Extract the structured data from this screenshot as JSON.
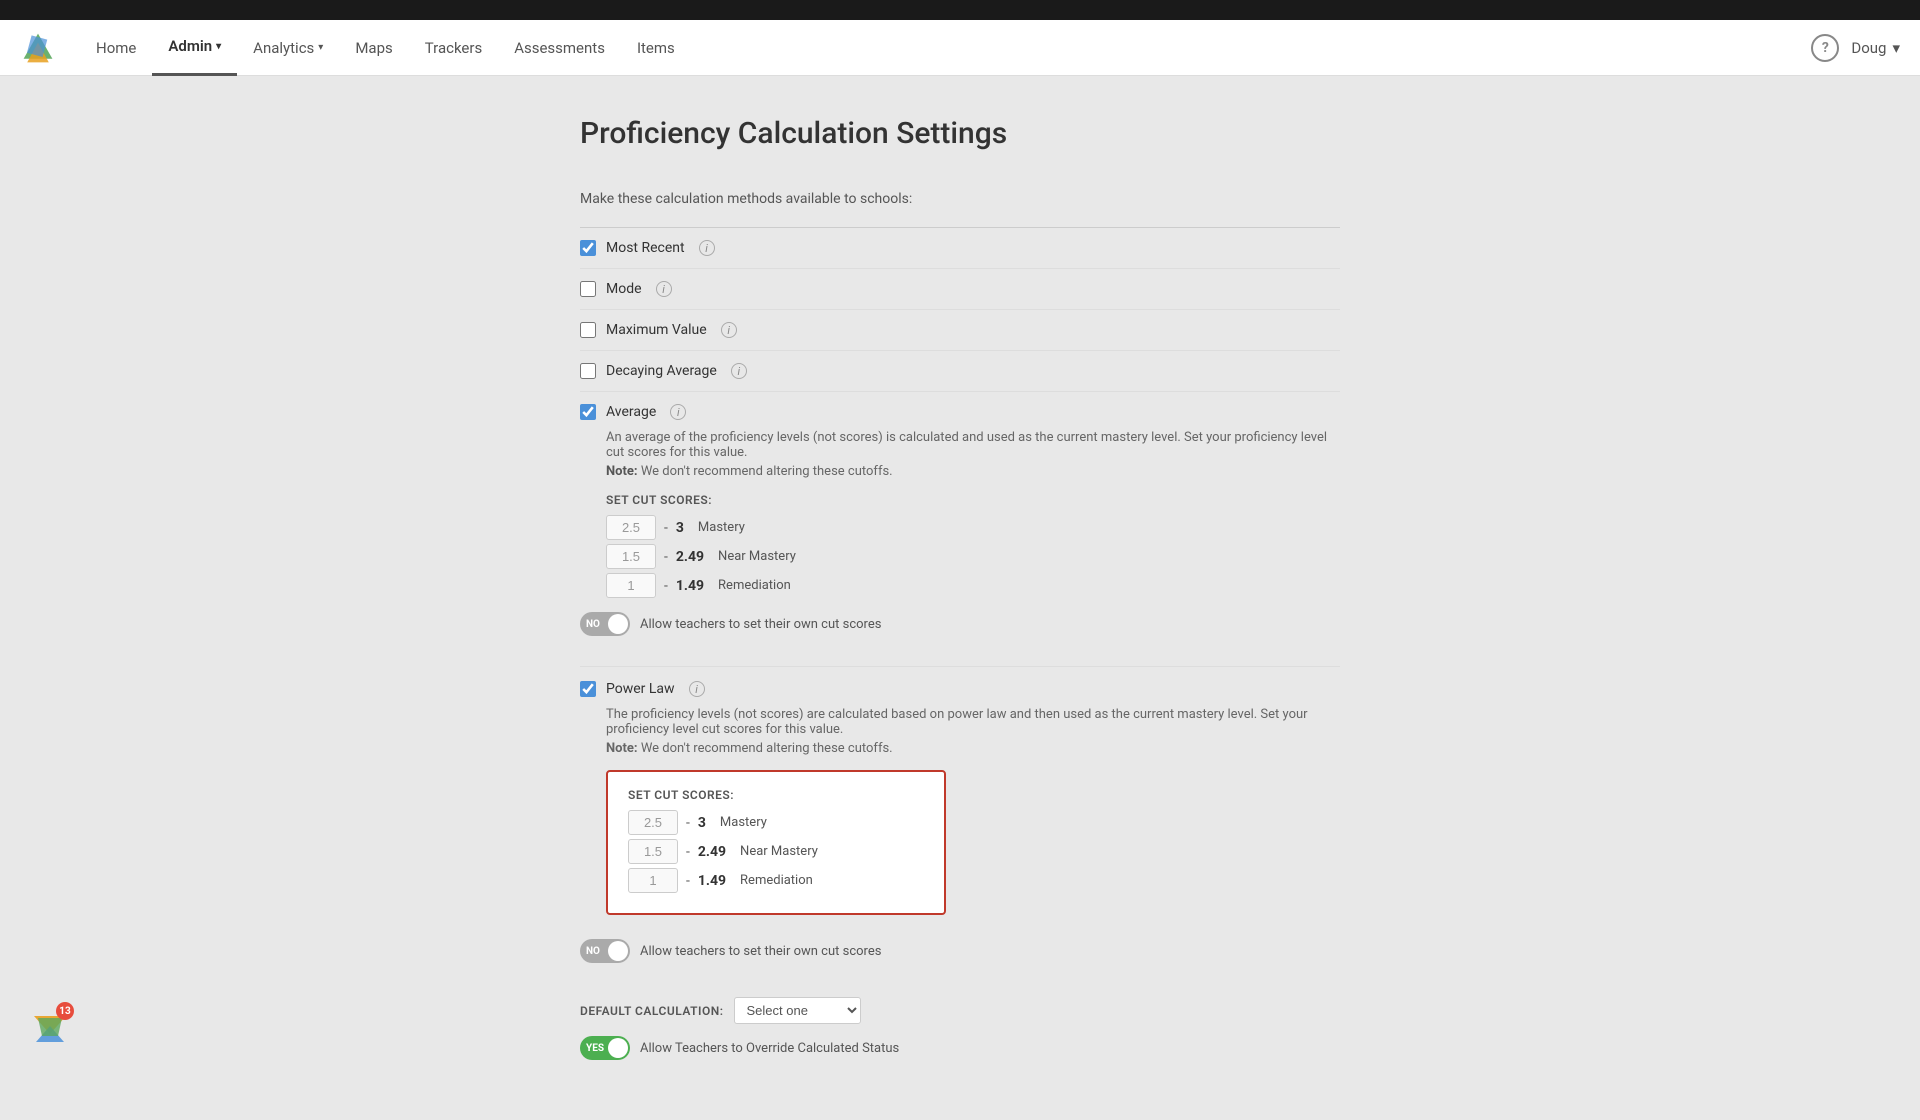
{
  "topBar": {},
  "navbar": {
    "brand": "Mastery Connect",
    "items": [
      {
        "label": "Home",
        "active": false,
        "hasArrow": false
      },
      {
        "label": "Admin",
        "active": true,
        "hasArrow": true
      },
      {
        "label": "Analytics",
        "active": false,
        "hasArrow": true
      },
      {
        "label": "Maps",
        "active": false,
        "hasArrow": false
      },
      {
        "label": "Trackers",
        "active": false,
        "hasArrow": false
      },
      {
        "label": "Assessments",
        "active": false,
        "hasArrow": false
      },
      {
        "label": "Items",
        "active": false,
        "hasArrow": false
      }
    ],
    "helpLabel": "?",
    "userName": "Doug",
    "userArrow": "▾"
  },
  "page": {
    "title": "Proficiency Calculation Settings",
    "sectionLabel": "Make these calculation methods available to schools:",
    "options": [
      {
        "label": "Most Recent",
        "checked": true,
        "hasInfo": true
      },
      {
        "label": "Mode",
        "checked": false,
        "hasInfo": true
      },
      {
        "label": "Maximum Value",
        "checked": false,
        "hasInfo": true
      },
      {
        "label": "Decaying Average",
        "checked": false,
        "hasInfo": true
      }
    ],
    "average": {
      "label": "Average",
      "checked": true,
      "hasInfo": true,
      "description": "An average of the proficiency levels (not scores) is calculated and used as the current mastery level. Set your proficiency level cut scores for this value.",
      "note": "Note:",
      "noteText": " We don't recommend altering these cutoffs.",
      "setCutScores": "SET CUT SCORES:",
      "scores": [
        {
          "from": "2.5",
          "to": "3",
          "label": "Mastery"
        },
        {
          "from": "1.5",
          "to": "2.49",
          "label": "Near Mastery"
        },
        {
          "from": "1",
          "to": "1.49",
          "label": "Remediation"
        }
      ],
      "toggle": "NO",
      "toggleText": "Allow teachers to set their own cut scores"
    },
    "powerLaw": {
      "label": "Power Law",
      "checked": true,
      "hasInfo": true,
      "description": "The proficiency levels (not scores) are calculated based on power law and then used as the current mastery level. Set your proficiency level cut scores for this value.",
      "note": "Note:",
      "noteText": " We don't recommend altering these cutoffs.",
      "setCutScores": "SET CUT SCORES:",
      "scores": [
        {
          "from": "2.5",
          "to": "3",
          "label": "Mastery"
        },
        {
          "from": "1.5",
          "to": "2.49",
          "label": "Near Mastery"
        },
        {
          "from": "1",
          "to": "1.49",
          "label": "Remediation"
        }
      ],
      "toggle": "NO",
      "toggleText": "Allow teachers to set their own cut scores"
    },
    "defaultCalc": {
      "label": "DEFAULT CALCULATION:",
      "selectPlaceholder": "Select one"
    },
    "allowTeachers": {
      "toggle": "YES",
      "text": "Allow Teachers to Override Calculated Status"
    }
  },
  "notification": {
    "badge": "13"
  }
}
